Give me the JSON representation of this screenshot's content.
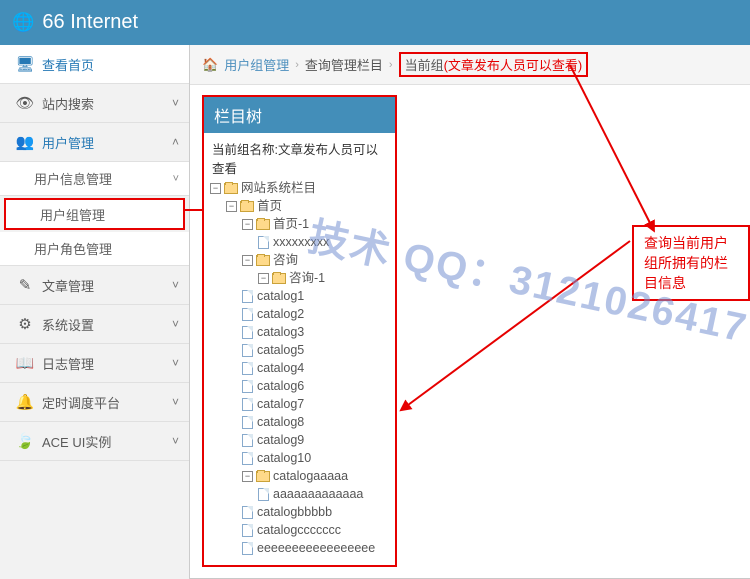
{
  "header": {
    "title": "66 Internet"
  },
  "sidebar": {
    "items": [
      {
        "icon": "🖥",
        "label": "查看首页",
        "kind": "item",
        "state": "active"
      },
      {
        "icon": "👁",
        "label": "站内搜索",
        "kind": "item",
        "chev": "˅"
      },
      {
        "icon": "👥",
        "label": "用户管理",
        "kind": "item",
        "state": "open",
        "chev": "˄"
      },
      {
        "label": "用户信息管理",
        "kind": "sub",
        "chev": "˅"
      },
      {
        "label": "用户组管理",
        "kind": "sub",
        "state": "selected"
      },
      {
        "label": "用户角色管理",
        "kind": "sub"
      },
      {
        "icon": "✎",
        "label": "文章管理",
        "kind": "item",
        "chev": "˅"
      },
      {
        "icon": "⚙",
        "label": "系统设置",
        "kind": "item",
        "chev": "˅"
      },
      {
        "icon": "📖",
        "label": "日志管理",
        "kind": "item",
        "chev": "˅"
      },
      {
        "icon": "🔔",
        "label": "定时调度平台",
        "kind": "item",
        "chev": "˅"
      },
      {
        "icon": "🍃",
        "label": "ACE UI实例",
        "kind": "item",
        "chev": "˅"
      }
    ]
  },
  "breadcrumb": {
    "link": "用户组管理",
    "mid": "查询管理栏目",
    "current_prefix": "当前组",
    "current_group": "(文章发布人员可以查看)"
  },
  "panel": {
    "title": "栏目树",
    "subtitle": "当前组名称:文章发布人员可以查看"
  },
  "tree": [
    {
      "d": 0,
      "t": "fd",
      "tg": "-",
      "label": "网站系统栏目"
    },
    {
      "d": 1,
      "t": "fd",
      "tg": "-",
      "label": "首页"
    },
    {
      "d": 2,
      "t": "fd",
      "tg": "-",
      "label": "首页-1"
    },
    {
      "d": 3,
      "t": "pg",
      "label": "xxxxxxxxx"
    },
    {
      "d": 2,
      "t": "fd",
      "tg": "-",
      "label": "咨询"
    },
    {
      "d": 3,
      "t": "fd",
      "tg": "-",
      "label": "咨询-1"
    },
    {
      "d": 2,
      "t": "pg",
      "label": "catalog1"
    },
    {
      "d": 2,
      "t": "pg",
      "label": "catalog2"
    },
    {
      "d": 2,
      "t": "pg",
      "label": "catalog3"
    },
    {
      "d": 2,
      "t": "pg",
      "label": "catalog5"
    },
    {
      "d": 2,
      "t": "pg",
      "label": "catalog4"
    },
    {
      "d": 2,
      "t": "pg",
      "label": "catalog6"
    },
    {
      "d": 2,
      "t": "pg",
      "label": "catalog7"
    },
    {
      "d": 2,
      "t": "pg",
      "label": "catalog8"
    },
    {
      "d": 2,
      "t": "pg",
      "label": "catalog9"
    },
    {
      "d": 2,
      "t": "pg",
      "label": "catalog10"
    },
    {
      "d": 2,
      "t": "fd",
      "tg": "-",
      "label": "catalogaaaaa"
    },
    {
      "d": 3,
      "t": "pg",
      "label": "aaaaaaaaaaaaa"
    },
    {
      "d": 2,
      "t": "pg",
      "label": "catalogbbbbb"
    },
    {
      "d": 2,
      "t": "pg",
      "label": "catalogccccccc"
    },
    {
      "d": 2,
      "t": "pg",
      "label": "eeeeeeeeeeeeeeeee"
    }
  ],
  "callout": {
    "text": "查询当前用户组所拥有的栏目信息"
  },
  "watermark": "技术 QQ：3121026417"
}
